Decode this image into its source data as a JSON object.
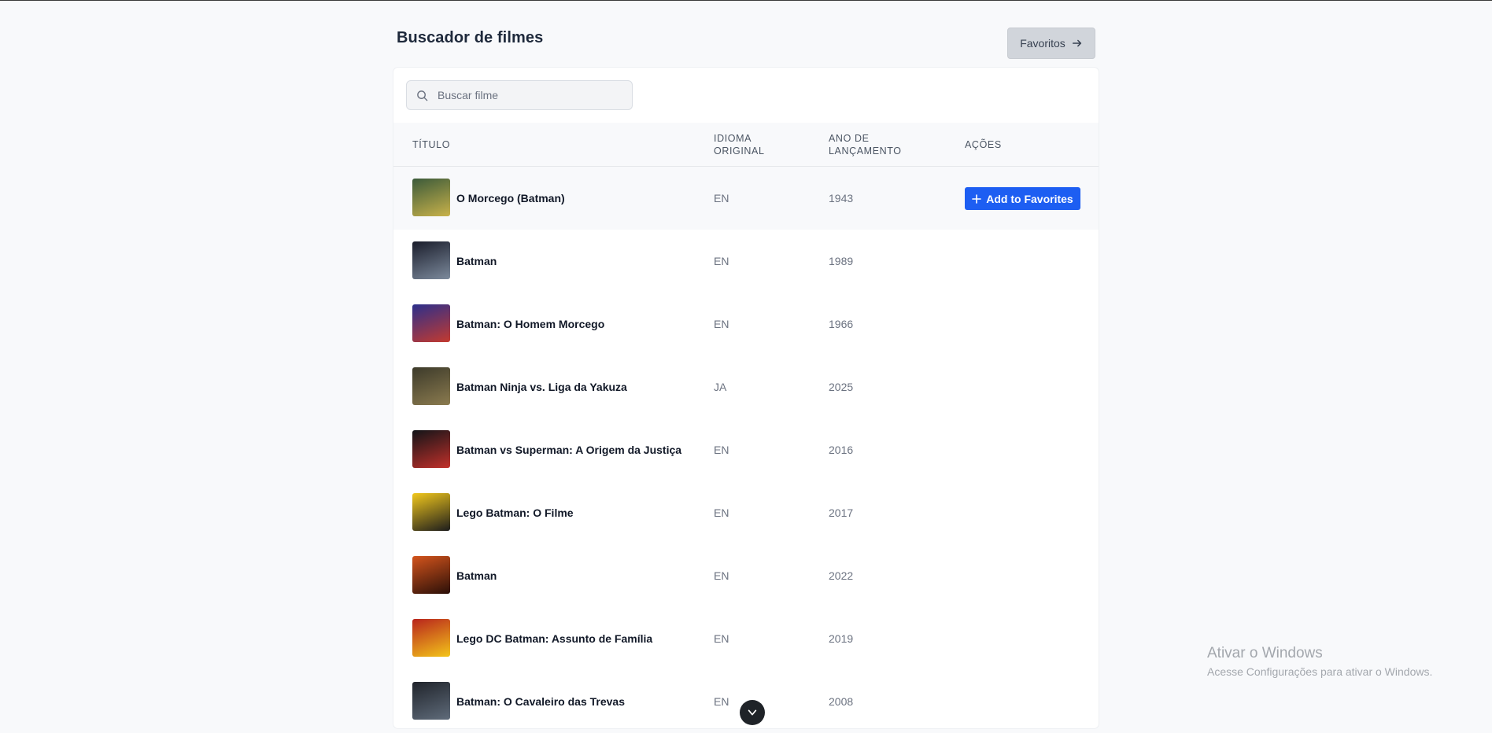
{
  "header": {
    "title": "Buscador de filmes",
    "favorites_label": "Favoritos",
    "favorites_icon": "arrow-right-icon"
  },
  "search": {
    "placeholder": "Buscar filme",
    "value": "",
    "icon": "search-icon"
  },
  "table": {
    "columns": {
      "title": "Título",
      "language_line1": "Idioma",
      "language_line2": "original",
      "year_line1": "Ano de",
      "year_line2": "lançamento",
      "actions": "Ações"
    },
    "add_to_favorites_label": "Add to Favorites",
    "rows": [
      {
        "title": "O Morcego (Batman)",
        "language": "EN",
        "year": "1943",
        "poster_colors": [
          "#3b5a3a",
          "#c9b24a"
        ],
        "hovered": true
      },
      {
        "title": "Batman",
        "language": "EN",
        "year": "1989",
        "poster_colors": [
          "#1a1d2b",
          "#7c8a9c"
        ]
      },
      {
        "title": "Batman: O Homem Morcego",
        "language": "EN",
        "year": "1966",
        "poster_colors": [
          "#2b2f8c",
          "#c43a2f"
        ]
      },
      {
        "title": "Batman Ninja vs. Liga da Yakuza",
        "language": "JA",
        "year": "2025",
        "poster_colors": [
          "#3c3a2a",
          "#8b7b4f"
        ]
      },
      {
        "title": "Batman vs Superman: A Origem da Justiça",
        "language": "EN",
        "year": "2016",
        "poster_colors": [
          "#121418",
          "#c2302a"
        ]
      },
      {
        "title": "Lego Batman: O Filme",
        "language": "EN",
        "year": "2017",
        "poster_colors": [
          "#f2c81c",
          "#1c1c1c"
        ]
      },
      {
        "title": "Batman",
        "language": "EN",
        "year": "2022",
        "poster_colors": [
          "#d4541c",
          "#2a0f08"
        ]
      },
      {
        "title": "Lego DC Batman: Assunto de Família",
        "language": "EN",
        "year": "2019",
        "poster_colors": [
          "#b8241c",
          "#f3c51a"
        ]
      },
      {
        "title": "Batman: O Cavaleiro das Trevas",
        "language": "EN",
        "year": "2008",
        "poster_colors": [
          "#20242b",
          "#5f6b7a"
        ]
      }
    ]
  },
  "watermark": {
    "title": "Ativar o Windows",
    "subtitle": "Acesse Configurações para ativar o Windows."
  }
}
